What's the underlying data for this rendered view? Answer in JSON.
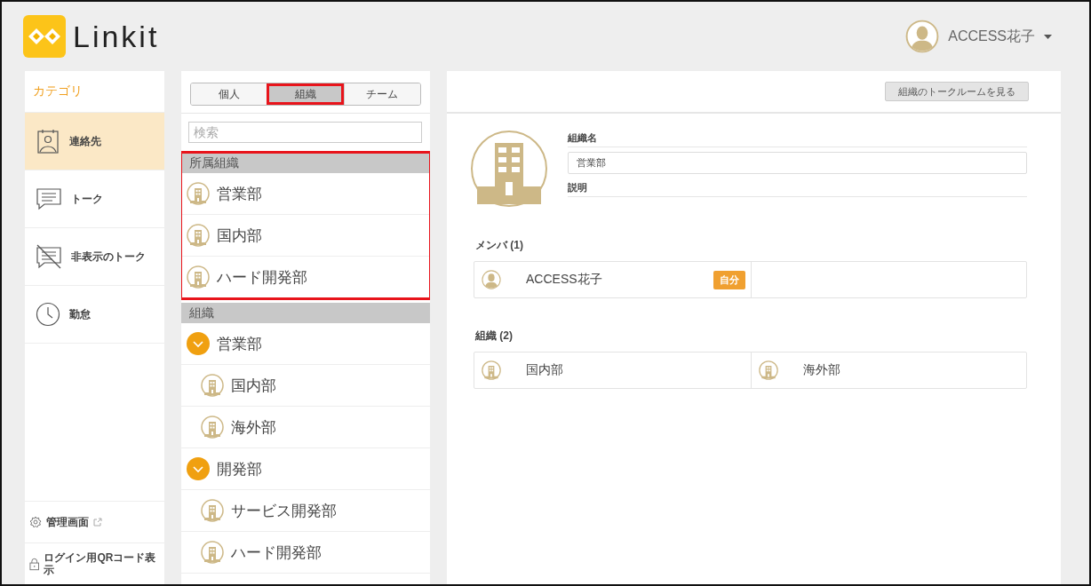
{
  "header": {
    "logo_text": "Linkit",
    "user_name": "ACCESS花子"
  },
  "sidebar": {
    "title": "カテゴリ",
    "items": [
      {
        "label": "連絡先",
        "kind": "contacts",
        "selected": true
      },
      {
        "label": "トーク",
        "kind": "talk",
        "selected": false
      },
      {
        "label": "非表示のトーク",
        "kind": "hidden-talk",
        "selected": false
      },
      {
        "label": "勤怠",
        "kind": "attendance",
        "selected": false
      }
    ],
    "footer_items": [
      {
        "label": "管理画面",
        "kind": "admin"
      },
      {
        "label": "ログイン用QRコード表示",
        "kind": "qr-login"
      }
    ]
  },
  "list_panel": {
    "tabs": [
      {
        "label": "個人",
        "selected": false,
        "highlighted": false
      },
      {
        "label": "組織",
        "selected": true,
        "highlighted": true
      },
      {
        "label": "チーム",
        "selected": false,
        "highlighted": false
      }
    ],
    "search": {
      "placeholder": "検索"
    },
    "affiliated": {
      "title": "所属組織",
      "highlighted": true,
      "items": [
        "営業部",
        "国内部",
        "ハード開発部"
      ]
    },
    "organizations": {
      "title": "組織",
      "tree": [
        {
          "label": "営業部",
          "expanded": true,
          "children": [
            {
              "label": "国内部"
            },
            {
              "label": "海外部"
            }
          ]
        },
        {
          "label": "開発部",
          "expanded": true,
          "children": [
            {
              "label": "サービス開発部"
            },
            {
              "label": "ハード開発部"
            }
          ]
        }
      ]
    }
  },
  "detail": {
    "talkroom_button": "組織のトークルームを見る",
    "name_label": "組織名",
    "name_value": "営業部",
    "description_label": "説明",
    "members": {
      "title": "メンバ (1)",
      "items": [
        {
          "name": "ACCESS花子",
          "badge": "自分"
        }
      ]
    },
    "sub_orgs": {
      "title": "組織 (2)",
      "items": [
        "国内部",
        "海外部"
      ]
    }
  }
}
